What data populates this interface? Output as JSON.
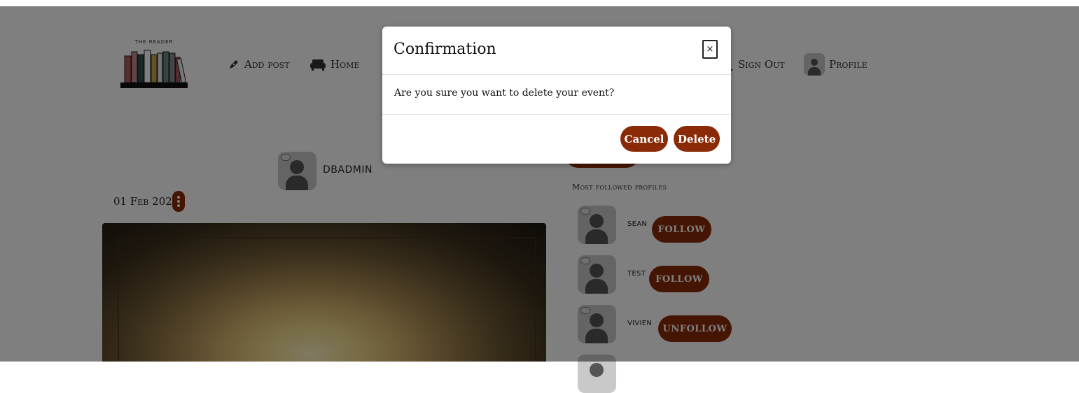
{
  "brand": {
    "logo_text": "THE READER"
  },
  "nav": {
    "add_post": "Add post",
    "home": "Home",
    "sign_out": "Sign Out",
    "profile": "Profile"
  },
  "post": {
    "author": "DBADMIN",
    "date": "01 Feb 2024"
  },
  "sidebar": {
    "title": "Most followed profiles",
    "profiles": [
      {
        "name": "SEAN",
        "action": "FOLLOW"
      },
      {
        "name": "TEST",
        "action": "FOLLOW"
      },
      {
        "name": "VIVIEN",
        "action": "UNFOLLOW"
      }
    ]
  },
  "modal": {
    "title": "Confirmation",
    "close_label": "×",
    "message": "Are you sure you want to delete your event?",
    "cancel_label": "Cancel",
    "delete_label": "Delete"
  },
  "colors": {
    "accent": "#8b2a06",
    "overlay": "rgba(0,0,0,0.5)",
    "avatar_bg": "#c9c9c9"
  },
  "icons": [
    "pen-icon",
    "sofa-icon",
    "door-icon",
    "avatar-icon",
    "kebab-icon",
    "close-icon"
  ]
}
